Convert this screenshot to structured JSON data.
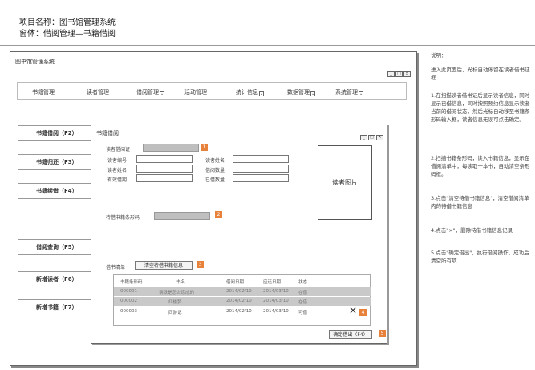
{
  "header": {
    "project_line": "项目名称：图书馆管理系统",
    "form_line": "窗体：借阅管理—书籍借阅"
  },
  "window": {
    "title": "图书馆管理系统",
    "buttons": [
      "_",
      "□",
      "×"
    ]
  },
  "menu": [
    {
      "label": "书籍管理",
      "dropdown": false
    },
    {
      "label": "读者管理",
      "dropdown": false
    },
    {
      "label": "借阅管理",
      "dropdown": true
    },
    {
      "label": "活动管理",
      "dropdown": false
    },
    {
      "label": "统计信息",
      "dropdown": true
    },
    {
      "label": "数据管理",
      "dropdown": true
    },
    {
      "label": "系统管理",
      "dropdown": true
    }
  ],
  "sidebar": [
    {
      "label": "书籍借阅（F2）"
    },
    {
      "label": "书籍归还（F3）"
    },
    {
      "label": "书籍续借（F4）"
    },
    {
      "label": "借阅查询（F5）"
    },
    {
      "label": "新增读者（F6）"
    },
    {
      "label": "新增书籍（F7）"
    }
  ],
  "dialog": {
    "title": "书籍借阅",
    "buttons": [
      "_",
      "□",
      "×"
    ],
    "reader_card_label": "读者借阅证",
    "reader_fields_left": [
      "读者编号",
      "读者姓名",
      "有效借期"
    ],
    "reader_fields_right": [
      "读者姓名",
      "借阅数量",
      "已借数量"
    ],
    "photo_label": "读者图片",
    "book_barcode_label": "待借书籍条形码",
    "list_label": "借书清单",
    "clear_button": "清空待借书籍信息",
    "grid_columns": [
      "书籍条形码",
      "书名",
      "借阅日期",
      "应还日期",
      "状态"
    ],
    "grid_rows": [
      [
        "000001",
        "钢铁是怎么炼成的",
        "2014/02/10",
        "2014/03/10",
        "在借"
      ],
      [
        "000002",
        "红楼梦",
        "2014/02/10",
        "2014/03/10",
        "在借"
      ],
      [
        "000003",
        "西游记",
        "2014/02/10",
        "2014/03/10",
        "可借"
      ]
    ],
    "delete_glyph": "✕",
    "confirm_button": "确定借出（F4）",
    "badges": [
      "1",
      "2",
      "3",
      "4",
      "5"
    ]
  },
  "notes": {
    "title": "说明：",
    "items": [
      "进入此页面后，光标自动停留在读者借书证框",
      "1.在扫描读者借书证后显示读者信息，同时显示已借信息，同时按照预约信息显示读者当前的借阅状态，然后光标自动移至书籍条形码输入框，读者信息无误可点击确定。",
      "2.扫描书籍条形码，读入书籍信息，显示在借阅清单中，每读取一本书，自动清空条形码框。",
      "3.点击\"清空待借书籍信息\"，清空借阅清单内的待借书籍信息",
      "4.点击\"×\"，删除待借书籍信息记录",
      "5.点击\"确定借出\"，执行借阅操作，成功后清空所有项"
    ]
  },
  "colors": {
    "accent": "#e8823a",
    "border": "#666666",
    "selected_row": "#c9c9c9"
  }
}
